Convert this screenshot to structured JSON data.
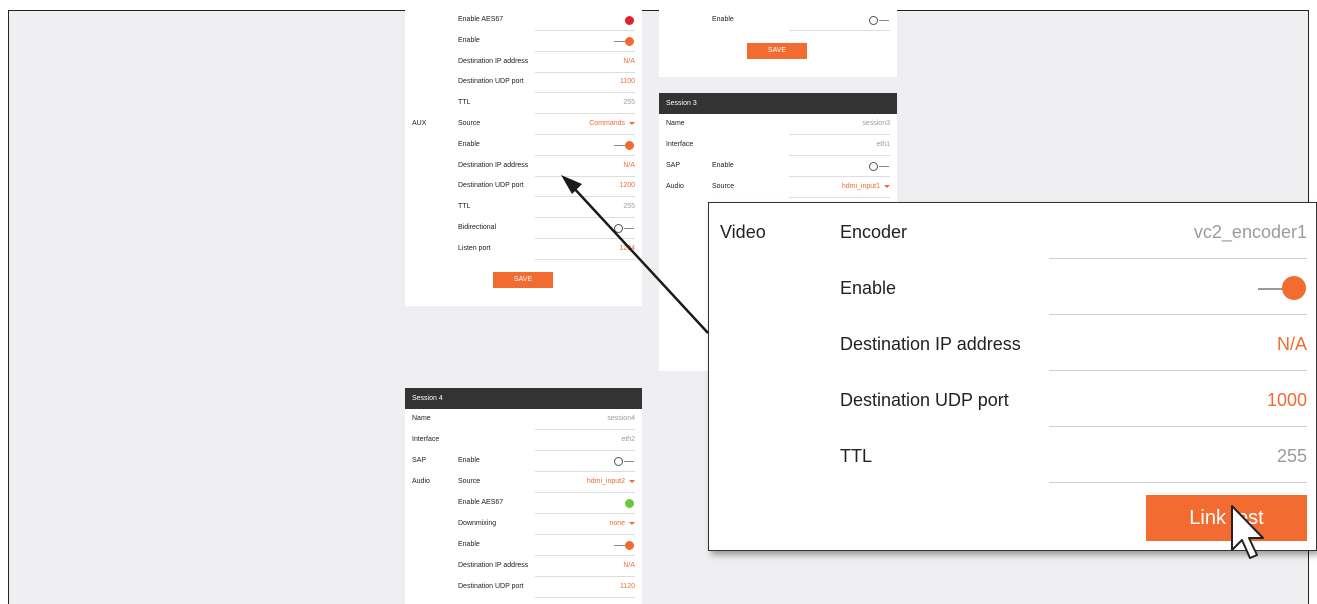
{
  "colors": {
    "accent": "#f26b30",
    "header": "#333333",
    "aes_red": "#e0202a",
    "aes_green": "#6bc83a",
    "background": "#efeef0"
  },
  "card_a": {
    "rows": [
      {
        "group": "",
        "label": "Enable AES67",
        "value": "",
        "control": "dot-red"
      },
      {
        "group": "",
        "label": "Enable",
        "value": "",
        "control": "toggle-on"
      },
      {
        "group": "",
        "label": "Destination IP address",
        "value": "N/A",
        "control": "text-orange"
      },
      {
        "group": "",
        "label": "Destination UDP port",
        "value": "1100",
        "control": "text-orange"
      },
      {
        "group": "",
        "label": "TTL",
        "value": "255",
        "control": "text"
      },
      {
        "group": "AUX",
        "label": "Source",
        "value": "Commands",
        "control": "select"
      },
      {
        "group": "",
        "label": "Enable",
        "value": "",
        "control": "toggle-on"
      },
      {
        "group": "",
        "label": "Destination IP address",
        "value": "N/A",
        "control": "text-orange"
      },
      {
        "group": "",
        "label": "Destination UDP port",
        "value": "1200",
        "control": "text-orange"
      },
      {
        "group": "",
        "label": "TTL",
        "value": "255",
        "control": "text"
      },
      {
        "group": "",
        "label": "Bidirectional",
        "value": "",
        "control": "toggle-off"
      },
      {
        "group": "",
        "label": "Listen port",
        "value": "1204",
        "control": "text-orange"
      }
    ],
    "save_label": "SAVE"
  },
  "card_b": {
    "rows": [
      {
        "group": "",
        "label": "Enable",
        "value": "",
        "control": "toggle-off"
      }
    ],
    "save_label": "SAVE"
  },
  "session3": {
    "title": "Session 3",
    "rows": [
      {
        "group": "Name",
        "label": "",
        "value": "session3",
        "control": "text"
      },
      {
        "group": "Interface",
        "label": "",
        "value": "eth1",
        "control": "text"
      },
      {
        "group": "SAP",
        "label": "Enable",
        "value": "",
        "control": "toggle-off"
      },
      {
        "group": "Audio",
        "label": "Source",
        "value": "hdmi_input1",
        "control": "select"
      }
    ]
  },
  "session4": {
    "title": "Session 4",
    "rows": [
      {
        "group": "Name",
        "label": "",
        "value": "session4",
        "control": "text"
      },
      {
        "group": "Interface",
        "label": "",
        "value": "eth2",
        "control": "text"
      },
      {
        "group": "SAP",
        "label": "Enable",
        "value": "",
        "control": "toggle-off"
      },
      {
        "group": "Audio",
        "label": "Source",
        "value": "hdmi_input2",
        "control": "select"
      },
      {
        "group": "",
        "label": "Enable AES67",
        "value": "",
        "control": "dot-green"
      },
      {
        "group": "",
        "label": "Downmixing",
        "value": "none",
        "control": "select"
      },
      {
        "group": "",
        "label": "Enable",
        "value": "",
        "control": "toggle-on"
      },
      {
        "group": "",
        "label": "Destination IP address",
        "value": "N/A",
        "control": "text-orange"
      },
      {
        "group": "",
        "label": "Destination UDP port",
        "value": "1120",
        "control": "text-orange"
      }
    ]
  },
  "zoom": {
    "rows": [
      {
        "group": "Video",
        "label": "Encoder",
        "value": "vc2_encoder1",
        "control": "text"
      },
      {
        "group": "",
        "label": "Enable",
        "value": "",
        "control": "toggle-on"
      },
      {
        "group": "",
        "label": "Destination IP address",
        "value": "N/A",
        "control": "text-orange"
      },
      {
        "group": "",
        "label": "Destination UDP port",
        "value": "1000",
        "control": "text-orange"
      },
      {
        "group": "",
        "label": "TTL",
        "value": "255",
        "control": "text"
      }
    ],
    "button_label": "Link test"
  }
}
